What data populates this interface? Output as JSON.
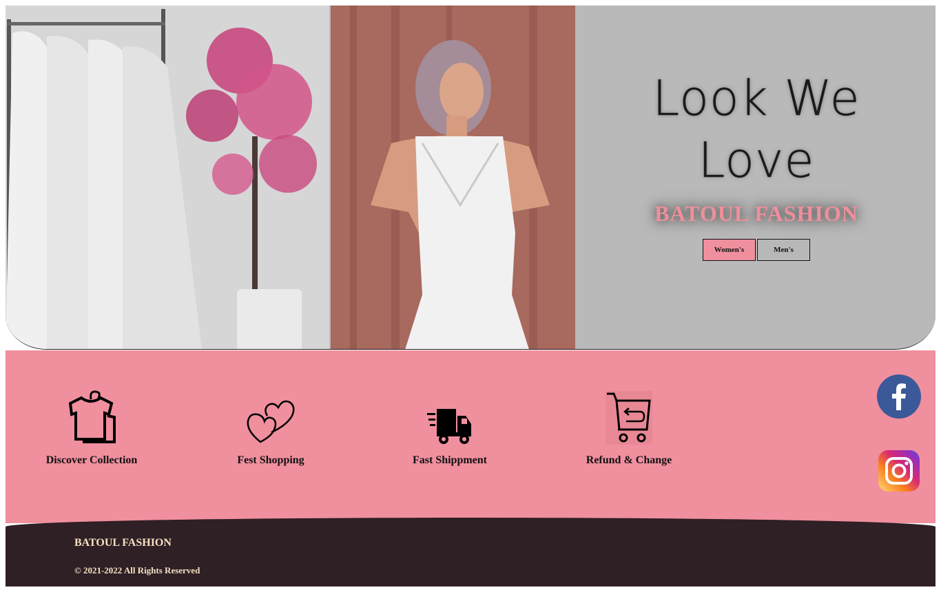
{
  "hero": {
    "tagline": "Look We Love",
    "brand": "BATOUL FASHION",
    "buttons": {
      "women": "Women's",
      "men": "Men's"
    },
    "colors": {
      "accent": "#f08f9e",
      "backdrop": "#bdbdbd"
    }
  },
  "features": {
    "items": [
      {
        "icon": "tshirt-hanger-icon",
        "label": "Discover Collection"
      },
      {
        "icon": "hearts-icon",
        "label": "Fest Shopping"
      },
      {
        "icon": "delivery-truck-icon",
        "label": "Fast Shippment"
      },
      {
        "icon": "cart-return-icon",
        "label": "Refund & Change"
      }
    ],
    "social": [
      {
        "icon": "facebook-icon"
      },
      {
        "icon": "instagram-icon"
      }
    ],
    "background": "#f08f9e"
  },
  "footer": {
    "brand": "BATOUL FASHION",
    "copyright": "© 2021-2022 All Rights Reserved",
    "background": "#2e2024",
    "text_color": "#f7e0c4"
  }
}
